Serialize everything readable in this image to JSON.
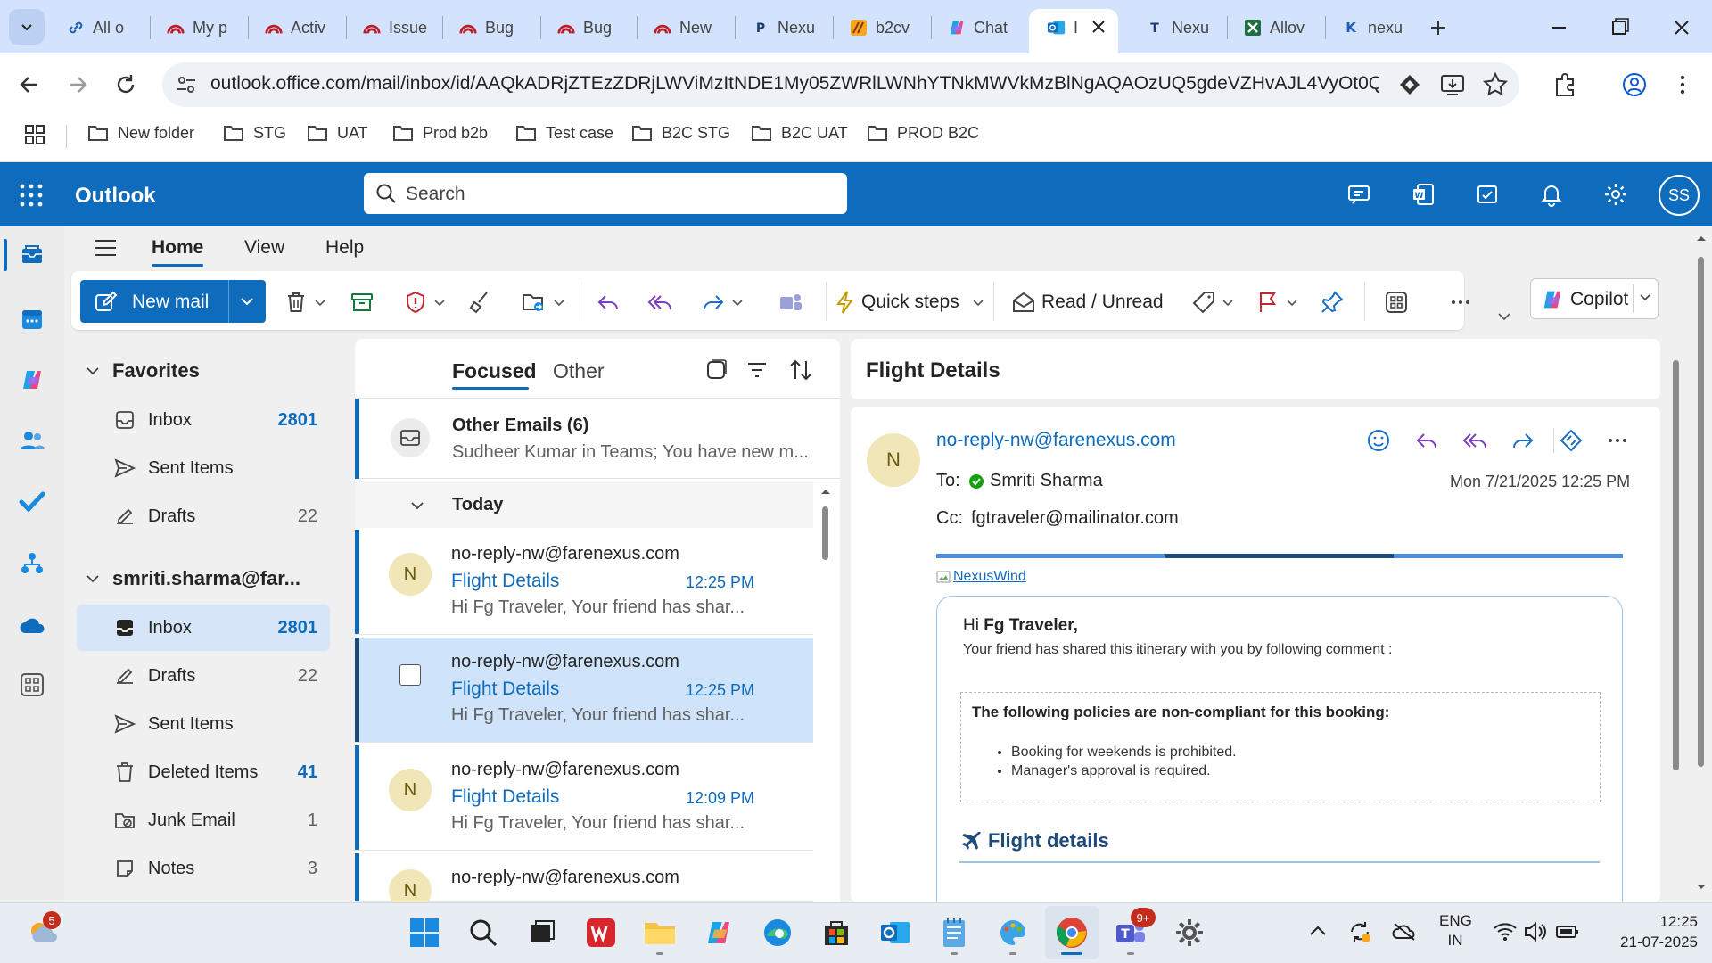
{
  "browser": {
    "tabs": [
      {
        "label": "All o",
        "icon": "link-icon"
      },
      {
        "label": "My p",
        "icon": "rainbow-logo-icon"
      },
      {
        "label": "Activ",
        "icon": "rainbow-logo-icon"
      },
      {
        "label": "Issue",
        "icon": "rainbow-logo-icon"
      },
      {
        "label": "Bug",
        "icon": "rainbow-logo-icon"
      },
      {
        "label": "Bug",
        "icon": "rainbow-logo-icon"
      },
      {
        "label": "New",
        "icon": "rainbow-logo-icon"
      },
      {
        "label": "Nexu",
        "icon": "p-logo-icon"
      },
      {
        "label": "b2cv",
        "icon": "stripes-logo-icon"
      },
      {
        "label": "Chat",
        "icon": "copilot-logo-icon"
      },
      {
        "label": "I",
        "icon": "outlook-logo-icon"
      },
      {
        "label": "Nexu",
        "icon": "t-logo-icon"
      },
      {
        "label": "Allov",
        "icon": "excel-logo-icon"
      },
      {
        "label": "nexu",
        "icon": "k-logo-icon"
      }
    ],
    "url": "outlook.office.com/mail/inbox/id/AAQkADRjZTEzZDRjLWViMzItNDE1My05ZWRlLWNhYTNkMWVkMzBlNgAQAOzUQ5gdeVZHvAJL4VyOt0Q...",
    "bookmarks": [
      "New folder",
      "STG",
      "UAT",
      "Prod b2b",
      "Test case",
      "B2C STG",
      "B2C UAT",
      "PROD B2C"
    ]
  },
  "outlook": {
    "app_name": "Outlook",
    "search_placeholder": "Search",
    "user_initials": "SS",
    "brand_color": "#0f6cbd"
  },
  "ribbon": {
    "menu_tabs": [
      "Home",
      "View",
      "Help"
    ],
    "new_mail": "New mail",
    "quick_steps": "Quick steps",
    "read_unread": "Read / Unread",
    "copilot": "Copilot"
  },
  "folders": {
    "favorites_label": "Favorites",
    "favorites": [
      {
        "name": "Inbox",
        "count": "2801",
        "icon": "inbox-icon"
      },
      {
        "name": "Sent Items",
        "count": "",
        "icon": "send-icon"
      },
      {
        "name": "Drafts",
        "count": "22",
        "icon": "draft-icon"
      }
    ],
    "account_label": "smriti.sharma@far...",
    "account_folders": [
      {
        "name": "Inbox",
        "count": "2801",
        "icon": "inbox-icon"
      },
      {
        "name": "Drafts",
        "count": "22",
        "icon": "draft-icon"
      },
      {
        "name": "Sent Items",
        "count": "",
        "icon": "send-icon"
      },
      {
        "name": "Deleted Items",
        "count": "41",
        "icon": "trash-icon"
      },
      {
        "name": "Junk Email",
        "count": "1",
        "icon": "junk-icon"
      },
      {
        "name": "Notes",
        "count": "3",
        "icon": "note-icon"
      }
    ]
  },
  "message_list": {
    "tab_focused": "Focused",
    "tab_other": "Other",
    "other_emails": {
      "title": "Other Emails (6)",
      "preview": "Sudheer Kumar in Teams; You have new m..."
    },
    "group_label": "Today",
    "messages": [
      {
        "avatar": "N",
        "from": "no-reply-nw@farenexus.com",
        "subject": "Flight Details",
        "time": "12:25 PM",
        "preview": "Hi Fg Traveler, Your friend has shar..."
      },
      {
        "avatar": "",
        "from": "no-reply-nw@farenexus.com",
        "subject": "Flight Details",
        "time": "12:25 PM",
        "preview": "Hi Fg Traveler, Your friend has shar..."
      },
      {
        "avatar": "N",
        "from": "no-reply-nw@farenexus.com",
        "subject": "Flight Details",
        "time": "12:09 PM",
        "preview": "Hi Fg Traveler, Your friend has shar..."
      },
      {
        "avatar": "N",
        "from": "no-reply-nw@farenexus.com",
        "subject": "",
        "time": "",
        "preview": ""
      }
    ]
  },
  "reading_pane": {
    "title": "Flight Details",
    "avatar": "N",
    "sender": "no-reply-nw@farenexus.com",
    "to_label": "To:",
    "to_name": "Smriti Sharma",
    "cc_label": "Cc:",
    "cc": "fgtraveler@mailinator.com",
    "date": "Mon 7/21/2025 12:25 PM",
    "logo_alt": "NexusWind",
    "greeting_prefix": "Hi ",
    "greeting_name": "Fg Traveler,",
    "intro": "Your friend has shared this itinerary with you by following comment :",
    "policy_title": "The following policies are non-compliant for this booking:",
    "policies": [
      "Booking for weekends is prohibited.",
      "Manager's approval is required."
    ],
    "flight_section": "Flight details"
  },
  "taskbar": {
    "weather_badge": "5",
    "teams_badge": "9+",
    "lang_top": "ENG",
    "lang_bottom": "IN",
    "time": "12:25",
    "date": "21-07-2025"
  }
}
